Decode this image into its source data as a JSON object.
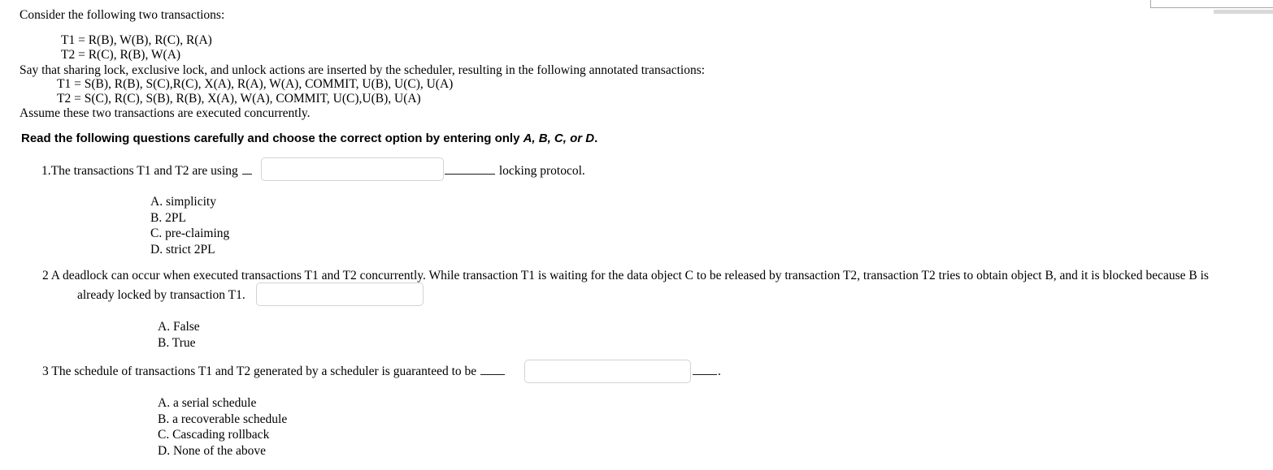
{
  "document": {
    "intro": "Consider the following two transactions:",
    "transactions_plain": [
      "T1 = R(B), W(B), R(C), R(A)",
      "T2 = R(C), R(B), W(A)"
    ],
    "scheduler_note": "Say that sharing lock, exclusive lock, and unlock actions are inserted by the scheduler, resulting in the following annotated transactions:",
    "transactions_annotated": [
      "T1 = S(B), R(B), S(C),R(C), X(A), R(A), W(A), COMMIT, U(B), U(C), U(A)",
      "T2 = S(C), R(C), S(B), R(B), X(A), W(A), COMMIT, U(C),U(B), U(A)"
    ],
    "assumption": "Assume these two transactions are executed concurrently."
  },
  "instruction": {
    "prefix": "Read the following questions carefully and choose the correct option by entering only ",
    "choices": "A, B, C, or D",
    "suffix": "."
  },
  "questions": [
    {
      "number": "1.",
      "text_before_blank": "The transactions T1 and T2 are using ",
      "text_after_blank": " locking protocol.",
      "input_value": "",
      "input_placeholder": "",
      "options": [
        "A. simplicity",
        "B. 2PL",
        "C. pre-claiming",
        "D. strict 2PL"
      ]
    },
    {
      "number": "2",
      "text_line1": " A deadlock can occur when executed transactions T1 and T2 concurrently.  While transaction T1 is waiting for the data object C to be released by transaction T2,  transaction T2 tries to obtain object B, and it is blocked because B is",
      "text_line2": "already locked by transaction T1.",
      "input_value": "",
      "input_placeholder": "",
      "options": [
        "A. False",
        "B. True"
      ]
    },
    {
      "number": "3",
      "text_before_blank": " The schedule of transactions T1 and T2 generated by a scheduler is guaranteed to be ",
      "text_after_blank": ".",
      "input_value": "",
      "input_placeholder": "",
      "options": [
        "A. a serial schedule",
        "B. a recoverable schedule",
        "C. Cascading rollback",
        "D. None of the above"
      ]
    }
  ]
}
